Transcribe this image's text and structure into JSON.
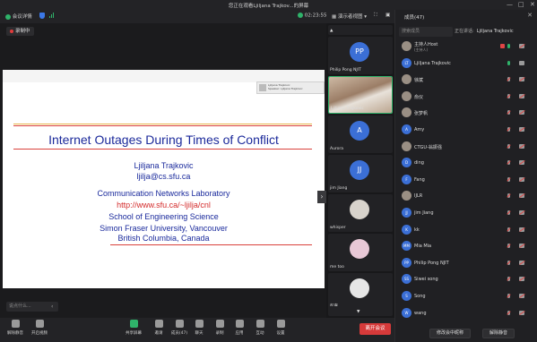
{
  "window": {
    "title": "您正在观看Ljiljana Trajkov...的屏幕",
    "title_icon": "cloud-icon",
    "controls": [
      "—",
      "□",
      "✕"
    ]
  },
  "toolbar": {
    "meeting_details": "会议详情",
    "timer": "02:23:55",
    "presenter_view": "演示者视图",
    "members_label": "成员(47)"
  },
  "recording": {
    "label": "录制中"
  },
  "slide": {
    "speaker_thumb": [
      "Ljiljana Trajkovic",
      "Speaker: Ljiljana Trajkovic"
    ],
    "title": "Internet Outages During Times of Conflict",
    "lines": [
      {
        "text": "Ljiljana Trajkovic",
        "style": "blue"
      },
      {
        "text": "ljilja@cs.sfu.ca",
        "style": "blue"
      },
      {
        "text": "Communication Networks Laboratory",
        "style": "blue"
      },
      {
        "text": "http://www.sfu.ca/~ljilja/cnl",
        "style": "red"
      },
      {
        "text": "School of Engineering Science",
        "style": "blue"
      },
      {
        "text": "Simon Fraser University, Vancouver",
        "style": "blue"
      },
      {
        "text": "British Columbia, Canada",
        "style": "blue"
      }
    ],
    "rule_color": "#d9413b"
  },
  "chat": {
    "placeholder": "说点什么..."
  },
  "tiles": [
    {
      "initials": "PP",
      "name": "Philip Pong NJIT",
      "kind": "avatar"
    },
    {
      "initials": "",
      "name": "Ljiljana Trajkovic",
      "kind": "camera"
    },
    {
      "initials": "A",
      "name": "Aurora",
      "kind": "avatar"
    },
    {
      "initials": "JJ",
      "name": "jim Jiang",
      "kind": "avatar"
    },
    {
      "initials": "",
      "name": "whisper",
      "kind": "photo"
    },
    {
      "initials": "",
      "name": "me too",
      "kind": "photo"
    },
    {
      "initials": "",
      "name": "彭嘉",
      "kind": "photo"
    }
  ],
  "panel": {
    "title": "成员(47)",
    "search_placeholder": "搜索成员",
    "speaking_label": "正在讲话:",
    "speaking_name": "Ljiljana Trajkovic",
    "participants": [
      {
        "initials": "",
        "name": "主持人Host",
        "sub": "(主持人)",
        "photo": true,
        "mic": "on",
        "video": "off",
        "share": true
      },
      {
        "initials": "LT",
        "name": "Ljiljana Trajkovic",
        "sub": "",
        "photo": false,
        "mic": "on",
        "video": "on",
        "share": false
      },
      {
        "initials": "",
        "name": "徐斌",
        "sub": "",
        "photo": true,
        "mic": "off",
        "video": "off",
        "share": false
      },
      {
        "initials": "",
        "name": "俞仪",
        "sub": "",
        "photo": true,
        "mic": "off",
        "video": "off",
        "share": false
      },
      {
        "initials": "",
        "name": "张梦帆",
        "sub": "",
        "photo": true,
        "mic": "off",
        "video": "off",
        "share": false
      },
      {
        "initials": "A",
        "name": "Amy",
        "sub": "",
        "photo": false,
        "mic": "off",
        "video": "off",
        "share": false
      },
      {
        "initials": "",
        "name": "CTGU-翁振强",
        "sub": "",
        "photo": true,
        "mic": "off",
        "video": "off",
        "share": false
      },
      {
        "initials": "D",
        "name": "ding",
        "sub": "",
        "photo": false,
        "mic": "off",
        "video": "off",
        "share": false
      },
      {
        "initials": "F",
        "name": "Fang",
        "sub": "",
        "photo": false,
        "mic": "off",
        "video": "off",
        "share": false
      },
      {
        "initials": "",
        "name": "IJLR",
        "sub": "",
        "photo": true,
        "mic": "off",
        "video": "off",
        "share": false
      },
      {
        "initials": "JJ",
        "name": "jim Jiang",
        "sub": "",
        "photo": false,
        "mic": "off",
        "video": "off",
        "share": false
      },
      {
        "initials": "K",
        "name": "kk",
        "sub": "",
        "photo": false,
        "mic": "off",
        "video": "off",
        "share": false
      },
      {
        "initials": "MM",
        "name": "Mia Mia",
        "sub": "",
        "photo": false,
        "mic": "off",
        "video": "off",
        "share": false
      },
      {
        "initials": "PP",
        "name": "Philip Pong NJIT",
        "sub": "",
        "photo": false,
        "mic": "off",
        "video": "off",
        "share": false
      },
      {
        "initials": "SS",
        "name": "Siwei song",
        "sub": "",
        "photo": false,
        "mic": "off",
        "video": "off",
        "share": false
      },
      {
        "initials": "S",
        "name": "Song",
        "sub": "",
        "photo": false,
        "mic": "off",
        "video": "off",
        "share": false
      },
      {
        "initials": "W",
        "name": "wang",
        "sub": "",
        "photo": false,
        "mic": "off",
        "video": "off",
        "share": false
      }
    ],
    "footer_buttons": [
      "修改会中昵称",
      "解除静音"
    ]
  },
  "bottombar": {
    "buttons": [
      {
        "label": "解除静音",
        "icon": "mic-muted-icon",
        "tone": "grey"
      },
      {
        "label": "开启视频",
        "icon": "camera-off-icon",
        "tone": "grey"
      },
      {
        "label": "共享屏幕",
        "icon": "share-screen-icon",
        "tone": "green"
      },
      {
        "label": "邀请",
        "icon": "invite-icon",
        "tone": "grey"
      },
      {
        "label": "成员(47)",
        "icon": "members-icon",
        "tone": "grey"
      },
      {
        "label": "聊天",
        "icon": "chat-icon",
        "tone": "grey"
      },
      {
        "label": "录制",
        "icon": "record-icon",
        "tone": "grey"
      },
      {
        "label": "应用",
        "icon": "apps-icon",
        "tone": "grey"
      },
      {
        "label": "互动",
        "icon": "reaction-icon",
        "tone": "grey"
      },
      {
        "label": "设置",
        "icon": "settings-icon",
        "tone": "grey"
      }
    ],
    "leave_label": "离开会议"
  },
  "colors": {
    "accent_green": "#2fb36a",
    "leave_red": "#d63a3a",
    "avatar_blue": "#3b6fd6",
    "slide_blue": "#1c2a9b"
  }
}
